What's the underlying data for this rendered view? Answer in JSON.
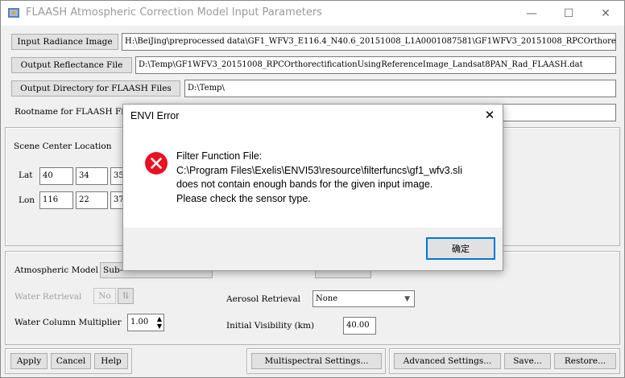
{
  "window": {
    "title": "FLAASH Atmospheric Correction Model Input Parameters",
    "minimize": "—",
    "maximize": "☐",
    "close": "✕"
  },
  "files": {
    "input_radiance_label": "Input Radiance Image",
    "input_radiance_value": "H:\\BeiJing\\preprocessed data\\GF1_WFV3_E116.4_N40.6_20151008_L1A0001087581\\GF1WFV3_20151008_RPCOrthore",
    "output_reflectance_label": "Output Reflectance File",
    "output_reflectance_value": "D:\\Temp\\GF1WFV3_20151008_RPCOrthorectificationUsingReferenceImage_Landsat8PAN_Rad_FLAASH.dat",
    "output_dir_label": "Output Directory for FLAASH Files",
    "output_dir_value": "D:\\Temp\\",
    "rootname_label": "Rootname for FLAASH Fil"
  },
  "scene": {
    "label": "Scene Center Location",
    "lat_label": "Lat",
    "lat_deg": "40",
    "lat_min": "34",
    "lat_sec": "35",
    "lon_label": "Lon",
    "lon_deg": "116",
    "lon_min": "22",
    "lon_sec": "37"
  },
  "atmos": {
    "model_label": "Atmospheric Model",
    "model_value": "Sub-",
    "water_retrieval_label": "Water Retrieval",
    "water_retrieval_value": "No",
    "water_column_label": "Water Column Multiplier",
    "water_column_value": "1.00",
    "aerosol_label": "Aerosol Retrieval",
    "aerosol_value": "None",
    "visibility_label": "Initial Visibility (km)",
    "visibility_value": "40.00"
  },
  "bottom": {
    "apply": "Apply",
    "cancel": "Cancel",
    "help": "Help",
    "multispectral": "Multispectral Settings...",
    "advanced": "Advanced Settings...",
    "save": "Save...",
    "restore": "Restore..."
  },
  "dialog": {
    "title": "ENVI Error",
    "close": "✕",
    "line1": "Filter Function File:",
    "line2": "C:\\Program Files\\Exelis\\ENVI53\\resource\\filterfuncs\\gf1_wfv3.sli",
    "line3": "does not contain enough bands for the given input image.",
    "line4": "Please check the sensor type.",
    "ok": "确定",
    "error_color": "#e81123"
  }
}
